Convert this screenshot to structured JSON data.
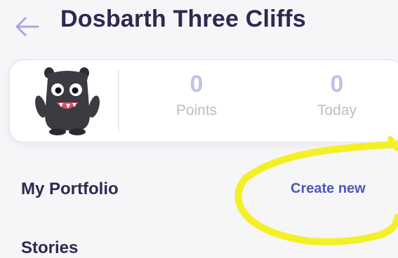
{
  "header": {
    "back_icon": "arrow-left-icon",
    "title": "Dosbarth Three Cliffs"
  },
  "stats": {
    "avatar_icon": "monster-avatar",
    "points": {
      "value": "0",
      "label": "Points"
    },
    "today": {
      "value": "0",
      "label": "Today"
    }
  },
  "portfolio": {
    "title": "My Portfolio",
    "create_new": "Create new"
  },
  "stories": {
    "title": "Stories"
  },
  "annotation": {
    "type": "yellow-hand-drawn-circle",
    "color": "#f4f025"
  },
  "colors": {
    "title": "#2c2a50",
    "accent": "#4a5bb5",
    "stat_value": "#bfc3e6",
    "back_arrow": "#a9a6e0"
  }
}
